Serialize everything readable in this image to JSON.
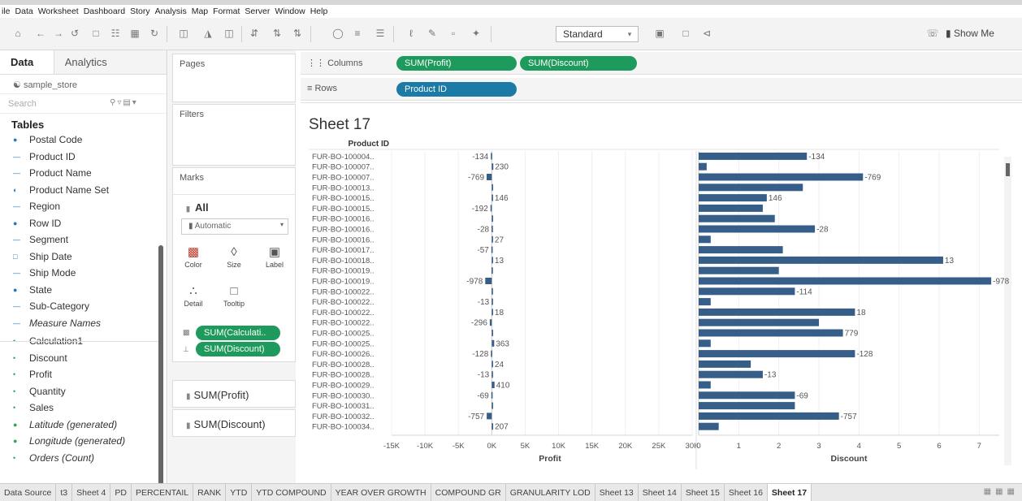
{
  "menu": [
    "ile",
    "Data",
    "Worksheet",
    "Dashboard",
    "Story",
    "Analysis",
    "Map",
    "Format",
    "Server",
    "Window",
    "Help"
  ],
  "toolbar": {
    "fit": "Standard",
    "show_me": "Show Me"
  },
  "data_pane": {
    "tab_data": "Data",
    "tab_analytics": "Analytics",
    "datasource": "sample_store",
    "search_placeholder": "Search",
    "tables_header": "Tables",
    "fields": [
      {
        "name": "Postal Code",
        "kind": "dim-geo",
        "italic": false
      },
      {
        "name": "Product ID",
        "kind": "dim",
        "italic": false
      },
      {
        "name": "Product Name",
        "kind": "dim",
        "italic": false
      },
      {
        "name": "Product Name Set",
        "kind": "dim-set",
        "italic": false
      },
      {
        "name": "Region",
        "kind": "dim",
        "italic": false
      },
      {
        "name": "Row ID",
        "kind": "dim-num",
        "italic": false
      },
      {
        "name": "Segment",
        "kind": "dim",
        "italic": false
      },
      {
        "name": "Ship Date",
        "kind": "dim-date",
        "italic": false
      },
      {
        "name": "Ship Mode",
        "kind": "dim",
        "italic": false
      },
      {
        "name": "State",
        "kind": "dim-geo",
        "italic": false
      },
      {
        "name": "Sub-Category",
        "kind": "dim",
        "italic": false
      },
      {
        "name": "Measure Names",
        "kind": "dim",
        "italic": true
      },
      {
        "name": "Calculation1",
        "kind": "mea-calc",
        "italic": false
      },
      {
        "name": "Discount",
        "kind": "mea",
        "italic": false
      },
      {
        "name": "Profit",
        "kind": "mea",
        "italic": false
      },
      {
        "name": "Quantity",
        "kind": "mea",
        "italic": false
      },
      {
        "name": "Sales",
        "kind": "mea",
        "italic": false
      },
      {
        "name": "Latitude (generated)",
        "kind": "mea-geo",
        "italic": true
      },
      {
        "name": "Longitude (generated)",
        "kind": "mea-geo",
        "italic": true
      },
      {
        "name": "Orders (Count)",
        "kind": "mea",
        "italic": true
      }
    ]
  },
  "cards": {
    "pages": "Pages",
    "filters": "Filters",
    "marks": "Marks",
    "all": "All",
    "mark_type": "Automatic",
    "buttons": [
      {
        "label": "Color",
        "icon": "color-icon"
      },
      {
        "label": "Size",
        "icon": "size-icon"
      },
      {
        "label": "Label",
        "icon": "label-icon"
      },
      {
        "label": "Detail",
        "icon": "detail-icon"
      },
      {
        "label": "Tooltip",
        "icon": "tooltip-icon"
      }
    ],
    "mark_pills": [
      "SUM(Calculati..",
      "SUM(Discount)"
    ],
    "measure_cards": [
      "SUM(Profit)",
      "SUM(Discount)"
    ]
  },
  "shelves": {
    "columns_label": "Columns",
    "rows_label": "Rows",
    "columns": [
      "SUM(Profit)",
      "SUM(Discount)"
    ],
    "rows": [
      "Product ID"
    ]
  },
  "sheet": {
    "title": "Sheet 17",
    "row_header": "Product ID"
  },
  "chart_data": {
    "type": "bar",
    "orientation": "horizontal",
    "categories": [
      "FUR-BO-100004..",
      "FUR-BO-100007..",
      "FUR-BO-100007..",
      "FUR-BO-100013..",
      "FUR-BO-100015..",
      "FUR-BO-100015..",
      "FUR-BO-100016..",
      "FUR-BO-100016..",
      "FUR-BO-100016..",
      "FUR-BO-100017..",
      "FUR-BO-100018..",
      "FUR-BO-100019..",
      "FUR-BO-100019..",
      "FUR-BO-100022..",
      "FUR-BO-100022..",
      "FUR-BO-100022..",
      "FUR-BO-100022..",
      "FUR-BO-100025..",
      "FUR-BO-100025..",
      "FUR-BO-100026..",
      "FUR-BO-100028..",
      "FUR-BO-100028..",
      "FUR-BO-100029..",
      "FUR-BO-100030..",
      "FUR-BO-100031..",
      "FUR-BO-100032..",
      "FUR-BO-100034.."
    ],
    "series": [
      {
        "name": "Profit",
        "values": [
          -134,
          230,
          -769,
          50,
          146,
          -192,
          40,
          -28,
          27,
          -57,
          13,
          -30,
          -978,
          -20,
          -13,
          18,
          -296,
          150,
          363,
          -128,
          24,
          -13,
          410,
          -69,
          40,
          -757,
          207
        ],
        "data_labels": [
          "-134",
          "230",
          "-769",
          "",
          "146",
          "-192",
          "",
          "-28",
          "27",
          "-57",
          "13",
          "",
          "-978",
          "",
          "-13",
          "18",
          "-296",
          "",
          "363",
          "-128",
          "24",
          "-13",
          "410",
          "-69",
          "",
          "-757",
          "207"
        ],
        "xlabel": "Profit",
        "xlim": [
          -15000,
          30000
        ],
        "ticks": [
          "-15K",
          "-10K",
          "-5K",
          "0K",
          "5K",
          "10K",
          "15K",
          "20K",
          "25K",
          "30K"
        ],
        "tick_values": [
          -15000,
          -10000,
          -5000,
          0,
          5000,
          10000,
          15000,
          20000,
          25000,
          30000
        ]
      },
      {
        "name": "Discount",
        "values": [
          2.7,
          0.2,
          4.1,
          2.6,
          1.7,
          1.6,
          1.9,
          2.9,
          0.3,
          2.1,
          6.1,
          2.0,
          7.3,
          2.4,
          0.3,
          3.9,
          3.0,
          3.6,
          0.3,
          3.9,
          1.3,
          1.6,
          0.3,
          2.4,
          2.4,
          3.5,
          0.5
        ],
        "data_labels": [
          "-134",
          "",
          "-769",
          "",
          "146",
          "",
          "",
          "-28",
          "",
          "",
          "13",
          "",
          "-978",
          "-114",
          "",
          "18",
          "",
          "779",
          "",
          "-128",
          "",
          "-13",
          "",
          "-69",
          "",
          "-757",
          ""
        ],
        "xlabel": "Discount",
        "xlim": [
          0,
          7.5
        ],
        "ticks": [
          "0",
          "1",
          "2",
          "3",
          "4",
          "5",
          "6",
          "7"
        ],
        "tick_values": [
          0,
          1,
          2,
          3,
          4,
          5,
          6,
          7
        ]
      }
    ],
    "bar_color": "#365e88",
    "grid": true
  },
  "sheet_tabs": [
    "Data Source",
    "t3",
    "Sheet 4",
    "PD",
    "PERCENTAIL",
    "RANK",
    "YTD",
    "YTD COMPOUND",
    "YEAR OVER GROWTH",
    "COMPOUND GR",
    "GRANULARITY LOD",
    "Sheet 13",
    "Sheet 14",
    "Sheet 15",
    "Sheet 16",
    "Sheet 17"
  ],
  "active_tab": "Sheet 17",
  "colors": {
    "pill_green": "#1f9a5d",
    "pill_blue": "#1c7aa6",
    "bar": "#365e88"
  }
}
